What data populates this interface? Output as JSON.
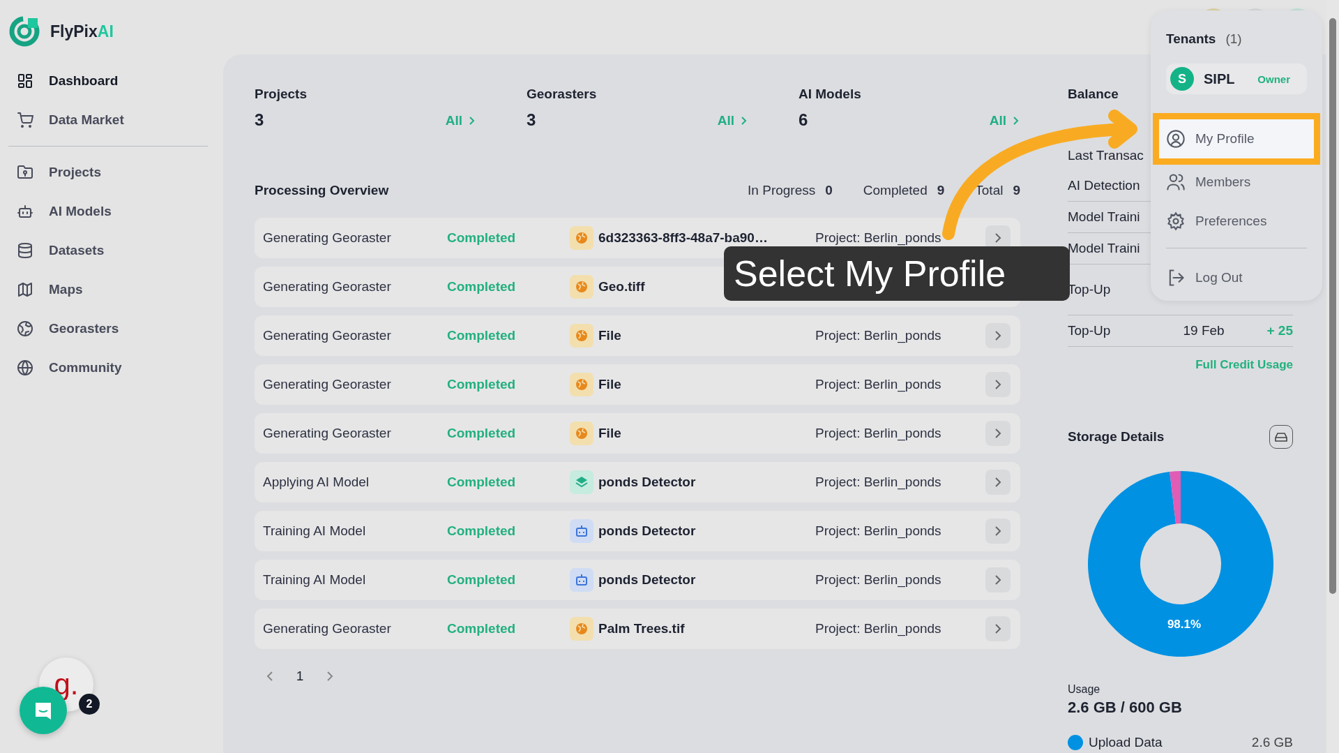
{
  "brand": {
    "name": "FlyPix",
    "suffix": "AI"
  },
  "sidebar": {
    "groups": [
      {
        "items": [
          {
            "label": "Dashboard",
            "selected": true
          },
          {
            "label": "Data Market",
            "selected": false
          }
        ]
      },
      {
        "items": [
          {
            "label": "Projects",
            "selected": false
          },
          {
            "label": "AI Models",
            "selected": false
          },
          {
            "label": "Datasets",
            "selected": false
          },
          {
            "label": "Maps",
            "selected": false
          },
          {
            "label": "Georasters",
            "selected": false
          },
          {
            "label": "Community",
            "selected": false
          }
        ]
      }
    ]
  },
  "stats": [
    {
      "title": "Projects",
      "value": "3",
      "link": "All"
    },
    {
      "title": "Georasters",
      "value": "3",
      "link": "All"
    },
    {
      "title": "AI Models",
      "value": "6",
      "link": "All"
    }
  ],
  "processing": {
    "title": "Processing Overview",
    "counts": [
      {
        "label": "In Progress",
        "value": "0"
      },
      {
        "label": "Completed",
        "value": "9"
      },
      {
        "label": "Total",
        "value": "9"
      }
    ],
    "rows": [
      {
        "task": "Generating Georaster",
        "status": "Completed",
        "kind": "georaster",
        "name": "6d323363-8ff3-48a7-ba90…",
        "project": "Project: Berlin_ponds"
      },
      {
        "task": "Generating Georaster",
        "status": "Completed",
        "kind": "georaster",
        "name": "Geo.tiff"
      },
      {
        "task": "Generating Georaster",
        "status": "Completed",
        "kind": "georaster",
        "name": "File",
        "project": "Project: Berlin_ponds"
      },
      {
        "task": "Generating Georaster",
        "status": "Completed",
        "kind": "georaster",
        "name": "File",
        "project": "Project: Berlin_ponds"
      },
      {
        "task": "Generating Georaster",
        "status": "Completed",
        "kind": "georaster",
        "name": "File",
        "project": "Project: Berlin_ponds"
      },
      {
        "task": "Applying AI Model",
        "status": "Completed",
        "kind": "model",
        "name": "ponds Detector",
        "project": "Project: Berlin_ponds"
      },
      {
        "task": "Training AI Model",
        "status": "Completed",
        "kind": "training",
        "name": "ponds Detector",
        "project": "Project: Berlin_ponds"
      },
      {
        "task": "Training AI Model",
        "status": "Completed",
        "kind": "training",
        "name": "ponds Detector",
        "project": "Project: Berlin_ponds"
      },
      {
        "task": "Generating Georaster",
        "status": "Completed",
        "kind": "georaster",
        "name": "Palm Trees.tif",
        "project": "Project: Berlin_ponds"
      }
    ],
    "pagination": {
      "page": "1"
    }
  },
  "balance": {
    "title": "Balance",
    "rows": [
      {
        "label": "Last Transac"
      },
      {
        "label": "AI Detection"
      },
      {
        "label": "Model Traini"
      },
      {
        "label": "Model Traini"
      },
      {
        "label": "Top-Up"
      },
      {
        "label": "Top-Up",
        "date": "19 Feb",
        "amount": "+ 25"
      }
    ],
    "link": "Full Credit Usage"
  },
  "storage": {
    "title": "Storage Details",
    "chart_data": {
      "type": "donut",
      "values": [
        98.1,
        1.9
      ],
      "value_labels": [
        "98.1%",
        null
      ]
    },
    "usage_label": "Usage",
    "usage": "2.6 GB / 600 GB",
    "legend": [
      {
        "name": "Upload Data",
        "color": "#0091e2",
        "value": "2.6 GB"
      }
    ]
  },
  "menu": {
    "title": "Tenants",
    "count": "(1)",
    "tenant": {
      "initial": "S",
      "name": "SIPL",
      "role": "Owner"
    },
    "items": [
      {
        "label": "My Profile",
        "highlighted": true
      },
      {
        "label": "Members",
        "highlighted": false
      },
      {
        "label": "Preferences",
        "highlighted": false
      }
    ],
    "footer_item": {
      "label": "Log Out"
    }
  },
  "callout": {
    "text": "Select My Profile"
  },
  "chat": {
    "badge": "2",
    "logo": "g."
  }
}
